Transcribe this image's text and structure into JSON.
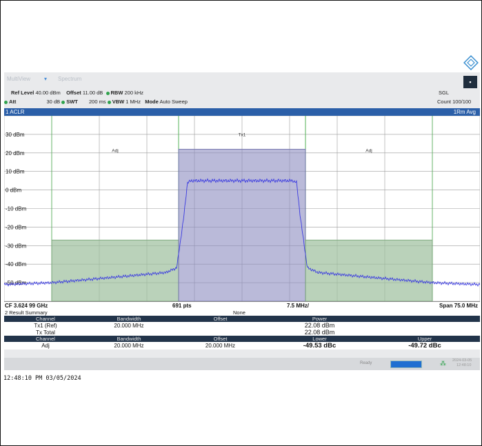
{
  "tabs": [
    "MultiView",
    "Spectrum"
  ],
  "settings": {
    "ref_level_label": "Ref Level",
    "ref_level": "40.00 dBm",
    "offset_label": "Offset",
    "offset": "11.00 dB",
    "rbw_label": "RBW",
    "rbw": "200 kHz",
    "att_label": "Att",
    "att": "30 dB",
    "swt_label": "SWT",
    "swt": "200 ms",
    "vbw_label": "VBW",
    "vbw": "1 MHz",
    "mode_label": "Mode",
    "mode": "Auto Sweep",
    "sgl": "SGL",
    "count": "Count 100/100"
  },
  "window": {
    "title": "1 ACLR",
    "trace": "1Rm Avg"
  },
  "chart_data": {
    "type": "line",
    "y_tick_labels": [
      "30 dBm",
      "20 dBm",
      "10 dBm",
      "0 dBm",
      "-10 dBm",
      "-20 dBm",
      "-30 dBm",
      "-40 dBm",
      "-50 dBm"
    ],
    "ylim": [
      -60,
      40
    ],
    "channel_labels": [
      "Adj",
      "Tx1",
      "Adj"
    ],
    "channels": [
      {
        "name": "Adj",
        "start_mhz": -30,
        "stop_mhz": -10,
        "level_dbm": -27
      },
      {
        "name": "Tx1",
        "start_mhz": -10,
        "stop_mhz": 10,
        "level_dbm": 22
      },
      {
        "name": "Adj",
        "start_mhz": 10,
        "stop_mhz": 30,
        "level_dbm": -27
      }
    ],
    "xlim_mhz": [
      -37.5,
      37.5
    ],
    "trace": {
      "name": "1Rm Avg",
      "x_mhz": [
        -37.5,
        -30,
        -20,
        -12,
        -10.3,
        -9.2,
        -8.6,
        -8,
        -6,
        -4,
        -2,
        0,
        2,
        4,
        6,
        8,
        8.6,
        9.2,
        10.3,
        12,
        20,
        30,
        37.5
      ],
      "y_dbm": [
        -51,
        -50,
        -47,
        -44.5,
        -42,
        -15,
        4,
        5,
        5,
        5,
        5,
        5,
        5,
        5,
        5,
        5,
        4,
        -15,
        -42,
        -44.5,
        -47,
        -50,
        -51
      ]
    },
    "grid": true,
    "footer": {
      "cf": "CF 3.624 99 GHz",
      "pts": "691 pts",
      "div": "7.5 MHz/",
      "span": "Span 75.0 MHz"
    }
  },
  "result_summary": {
    "title": "2 Result Summary",
    "mode": "None",
    "headers1": [
      "Channel",
      "Bandwidth",
      "Offset",
      "Power"
    ],
    "rows1": [
      {
        "channel": "Tx1 (Ref)",
        "bandwidth": "20.000 MHz",
        "offset": "",
        "power": "22.08 dBm"
      },
      {
        "channel": "Tx Total",
        "bandwidth": "",
        "offset": "",
        "power": "22.08 dBm"
      }
    ],
    "headers2": [
      "Channel",
      "Bandwidth",
      "Offset",
      "Lower",
      "Upper"
    ],
    "rows2": [
      {
        "channel": "Adj",
        "bandwidth": "20.000 MHz",
        "offset": "20.000 MHz",
        "lower": "-49.53 dBc",
        "upper": "-49.72 dBc"
      }
    ]
  },
  "status": {
    "ready": "Ready",
    "date": "2024-03-05",
    "time": "12:48:10"
  },
  "timestamp": "12:48:10 PM  03/05/2024",
  "colors": {
    "titlebar": "#2b5fa8",
    "tx_channel": "#8c8cc0",
    "adj_channel": "#9dbf9d",
    "trace": "#3a3ae0"
  }
}
